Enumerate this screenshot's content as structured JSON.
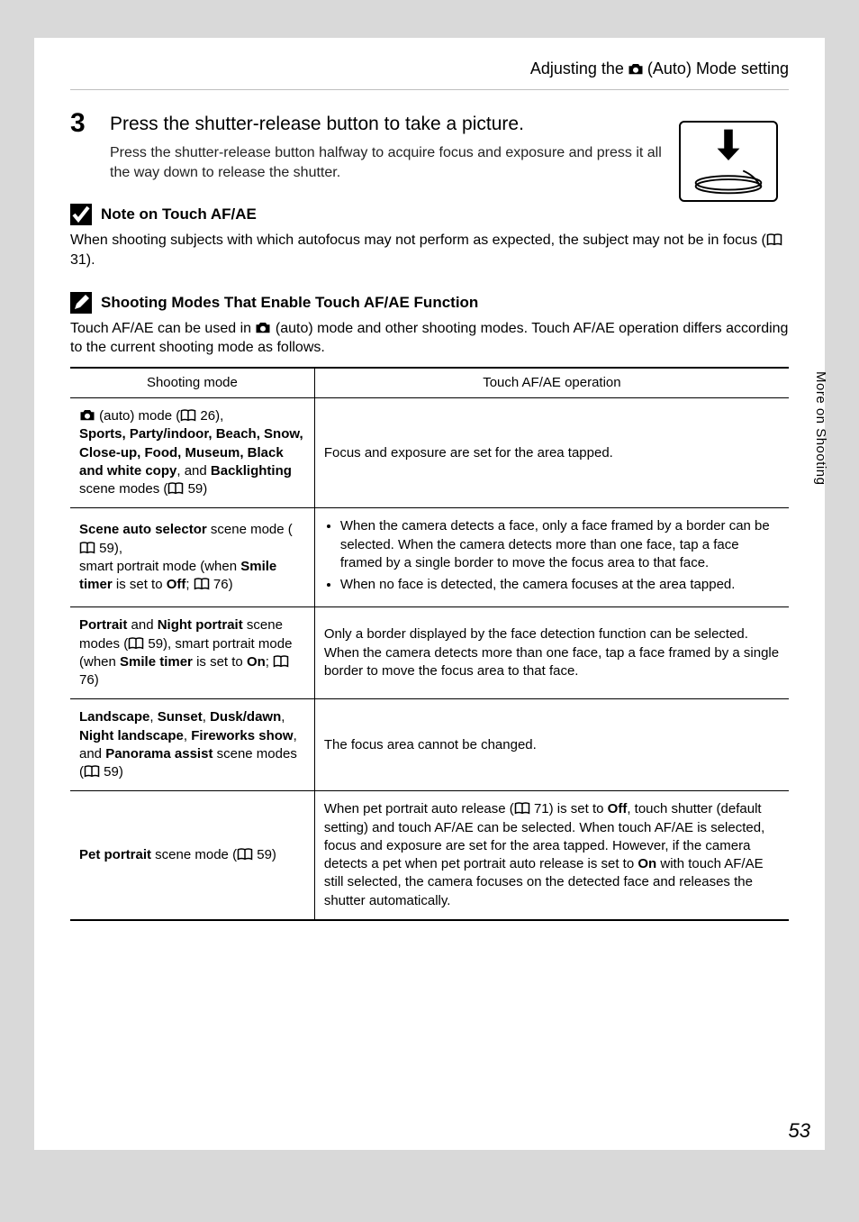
{
  "header": {
    "before": "Adjusting the",
    "after": "(Auto) Mode setting"
  },
  "step": {
    "number": "3",
    "title": "Press the shutter-release button to take a picture.",
    "description": "Press the shutter-release button halfway to acquire focus and exposure and press it all the way down to release the shutter."
  },
  "note1": {
    "title": "Note on Touch AF/AE",
    "body_before": "When shooting subjects with which autofocus may not perform as expected, the subject may not be in focus (",
    "body_ref": "31",
    "body_after": ")."
  },
  "note2": {
    "title": "Shooting Modes That Enable Touch AF/AE Function",
    "body_before": "Touch AF/AE can be used in ",
    "body_after": " (auto) mode and other shooting modes. Touch AF/AE operation differs according to the current shooting mode as follows."
  },
  "table": {
    "head_left": "Shooting mode",
    "head_right": "Touch AF/AE operation",
    "rows": {
      "r1": {
        "left_auto_after": " (auto) mode (",
        "left_ref1": "26",
        "left_bold": "Sports, Party/indoor, Beach, Snow, Close-up, Food, Museum, Black and white copy",
        "left_and": ", and ",
        "left_bold2": "Backlighting",
        "left_tail": " scene modes (",
        "left_ref2": "59",
        "right": "Focus and exposure are set for the area tapped."
      },
      "r2": {
        "left_b1": "Scene auto selector",
        "left_t1": " scene mode (",
        "left_ref1": "59",
        "left_t2": "),",
        "left_t3": "smart portrait mode (when ",
        "left_b2": "Smile timer",
        "left_t4": " is set to ",
        "left_b3": "Off",
        "left_t5": "; ",
        "left_ref2": "76",
        "right_li1": "When the camera detects a face, only a face framed by a border can be selected. When the camera detects more than one face, tap a face framed by a single border to move the focus area to that face.",
        "right_li2": "When no face is detected, the camera focuses at the area tapped."
      },
      "r3": {
        "left_b1": "Portrait",
        "left_t1": " and ",
        "left_b2": "Night portrait",
        "left_t2": " scene modes (",
        "left_ref1": "59",
        "left_t3": "), smart portrait mode (when ",
        "left_b3": "Smile timer",
        "left_t4": " is set to ",
        "left_b4": "On",
        "left_t5": "; ",
        "left_ref2": "76",
        "right": "Only a border displayed by the face detection function can be selected. When the camera detects more than one face, tap a face framed by a single border to move the focus area to that face."
      },
      "r4": {
        "left_b1": "Landscape",
        "left_t1": ", ",
        "left_b2": "Sunset",
        "left_t2": ", ",
        "left_b3": "Dusk/dawn",
        "left_t3": ", ",
        "left_b4": "Night landscape",
        "left_t4": ", ",
        "left_b5": "Fireworks show",
        "left_t5": ", and ",
        "left_b6": "Panorama assist",
        "left_t6": " scene modes (",
        "left_ref": "59",
        "right": "The focus area cannot be changed."
      },
      "r5": {
        "left_b1": "Pet portrait",
        "left_t1": " scene mode (",
        "left_ref": "59",
        "right_p1": "When pet portrait auto release (",
        "right_ref": "71",
        "right_p2": ") is set to ",
        "right_b1": "Off",
        "right_p3": ", touch shutter (default setting) and touch AF/AE can be selected. When touch AF/AE is selected, focus and exposure are set for the area tapped. However, if the camera detects a pet when pet portrait auto release is set to ",
        "right_b2": "On",
        "right_p4": " with touch AF/AE still selected, the camera focuses on the detected face and releases the shutter automatically."
      }
    }
  },
  "side_tab": "More on Shooting",
  "page_number": "53"
}
